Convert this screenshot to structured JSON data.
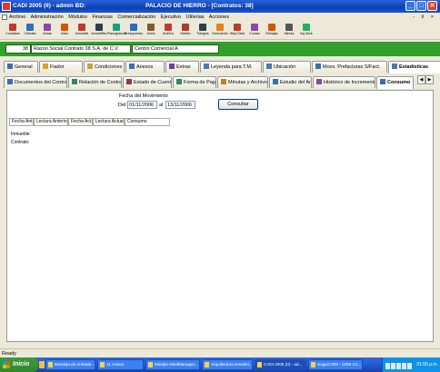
{
  "window": {
    "title_left": "CADI  2005 (II) - admin    BD:",
    "title_center": "PALACIO DE HIERRO - [Contratos: 38]",
    "btn_min": "_",
    "btn_max": "□",
    "btn_close": "✕"
  },
  "menu": {
    "items": [
      "Archivo",
      "Administración",
      "Módulos",
      "Finanzas",
      "Comercialización",
      "Ejecutivo",
      "Utilerias",
      "Acciones"
    ],
    "mdi_controls": "- ♯ ×"
  },
  "toolbar": [
    {
      "label": "Contratos",
      "icon": "contracts-icon",
      "color": "#c0392b"
    },
    {
      "label": "Clientes",
      "icon": "clients-icon",
      "color": "#2c6fbb"
    },
    {
      "label": "Areas",
      "icon": "areas-icon",
      "color": "#8e44ad"
    },
    {
      "label": "Inicio",
      "icon": "home-icon",
      "color": "#d35400"
    },
    {
      "label": "Inmueble",
      "icon": "building-icon",
      "color": "#c0392b"
    },
    {
      "label": "InmobMtto",
      "icon": "maintenance-icon",
      "color": "#2c3e50"
    },
    {
      "label": "Planogramas",
      "icon": "planogram-icon",
      "color": "#16a085"
    },
    {
      "label": "Presupuesto",
      "icon": "budget-icon",
      "color": "#2c6fbb"
    },
    {
      "label": "Juicio",
      "icon": "gavel-icon",
      "color": "#7f5a2a"
    },
    {
      "label": "Archivo",
      "icon": "archive-icon",
      "color": "#c0392b"
    },
    {
      "label": "Mantto",
      "icon": "tools-icon",
      "color": "#b03a2e"
    },
    {
      "label": "Tianguis",
      "icon": "market-icon",
      "color": "#2c3e50"
    },
    {
      "label": "Descuento",
      "icon": "discount-icon",
      "color": "#e67e22"
    },
    {
      "label": "Help Desk",
      "icon": "help-icon",
      "color": "#c0392b"
    },
    {
      "label": "Cuotas",
      "icon": "fees-icon",
      "color": "#8e44ad"
    },
    {
      "label": "Rebajas",
      "icon": "sale-icon",
      "color": "#d35400"
    },
    {
      "label": "Minuta",
      "icon": "minutes-icon",
      "color": "#555555"
    },
    {
      "label": "hoj deck",
      "icon": "sheet-icon",
      "color": "#27ae60"
    }
  ],
  "infobar": {
    "contract_number": "38",
    "razon_social": "Razon Social Contrato 38 S.A. de C.V.",
    "centro": "Centro Comercial A",
    "bg_color": "#33a02c"
  },
  "tabs_row1": [
    {
      "label": "General",
      "icon": "general-icon",
      "color": "#3a6fb0"
    },
    {
      "label": "Fiador",
      "icon": "guarantor-icon",
      "color": "#e0a020"
    },
    {
      "label": "Condiciones",
      "icon": "conditions-icon",
      "color": "#c9a13a"
    },
    {
      "label": "Anexos",
      "icon": "annex-icon",
      "color": "#3a6fb0"
    },
    {
      "label": "Extras",
      "icon": "extras-icon",
      "color": "#6b3fa0"
    },
    {
      "label": "Leyenda para T.M.",
      "icon": "legend-icon",
      "color": "#4a7ab0"
    },
    {
      "label": "Ubicación",
      "icon": "location-icon",
      "color": "#4a7ab0"
    },
    {
      "label": "Movs. Prefacturas S/Fact.",
      "icon": "prefactura-icon",
      "color": "#3a6fb0"
    },
    {
      "label": "Estadísticas",
      "icon": "stats-icon",
      "color": "#4a7ab0",
      "active": true
    }
  ],
  "tabs_row2": [
    {
      "label": "Documentos del Contrato",
      "icon": "documents-icon",
      "color": "#3a6fb0"
    },
    {
      "label": "Relación de Contratos",
      "icon": "relation-icon",
      "color": "#2e8b57"
    },
    {
      "label": "Estado de Cuenta",
      "icon": "account-statement-icon",
      "color": "#8e3a3a"
    },
    {
      "label": "Forma de Pago",
      "icon": "payment-icon",
      "color": "#2e8b57"
    },
    {
      "label": "Minutas y Archivos",
      "icon": "files-icon",
      "color": "#b8860b"
    },
    {
      "label": "Estudio del Area",
      "icon": "area-study-icon",
      "color": "#3a6fb0"
    },
    {
      "label": "Histórico de Incrementos",
      "icon": "history-icon",
      "color": "#7a4fa0"
    },
    {
      "label": "Consumo",
      "icon": "consumption-icon",
      "color": "#3a6fb0",
      "active": true
    }
  ],
  "tab_scroll": {
    "left": "◀",
    "right": "▶"
  },
  "filter": {
    "title": "Fecha del Movimiento",
    "del_label": "Del:",
    "from_date": "01/11/2006",
    "al_label": "al",
    "to_date": "13/11/2006",
    "button": "Consultar"
  },
  "grid": {
    "columns": [
      "Fecha Ant.",
      "Lectura Anterior",
      "Fecha Act.",
      "Lectura Actual",
      "Consumo"
    ],
    "labels": [
      "Inmueble:",
      "Contrato:"
    ]
  },
  "status": "Ready",
  "taskbar": {
    "start_label": "Inicio",
    "tasks": [
      {
        "label": "Bandeja de entrada -..."
      },
      {
        "label": "11 Avisos"
      },
      {
        "label": "Mindjet MindManager..."
      },
      {
        "label": "Arquitectura sesaleri..."
      },
      {
        "label": "CADI  2005 (II) - ad...",
        "active": true
      },
      {
        "label": "SugarCRM - CRM Co..."
      }
    ],
    "clock": "01:55 p.m."
  }
}
